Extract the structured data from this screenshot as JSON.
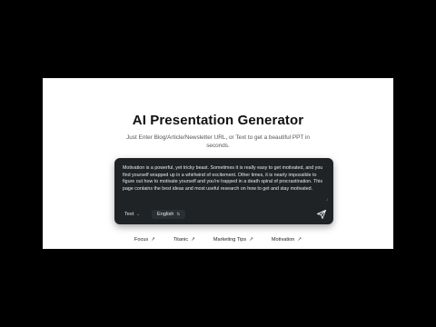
{
  "hero": {
    "title": "AI Presentation Generator",
    "subtitle": "Just Enter Blog/Article/Newsletter URL, or Text to get a beautiful PPT in seconds."
  },
  "input_card": {
    "text": "Motivation is a powerful, yet tricky beast. Sometimes it is really easy to get motivated, and you find yourself wrapped up in a whirlwind of excitement. Other times, it is nearly impossible to figure out how to motivate yourself and you're trapped in a death spiral of procrastination. This page contains the best ideas and most useful research on how to get and stay motivated.",
    "mode_select": {
      "value": "Text",
      "icon": "chevron-down-icon"
    },
    "language_select": {
      "value": "English",
      "icon": "up-down-chevron-icon"
    },
    "send_icon": "send-icon"
  },
  "suggestions": [
    {
      "label": "Focus",
      "icon": "arrow-up-right-icon"
    },
    {
      "label": "Titanic",
      "icon": "arrow-up-right-icon"
    },
    {
      "label": "Marketing Tips",
      "icon": "arrow-up-right-icon"
    },
    {
      "label": "Motivation",
      "icon": "arrow-up-right-icon"
    }
  ],
  "colors": {
    "background": "#000000",
    "page": "#ffffff",
    "card": "#1f2326",
    "card_text": "#e8eaec"
  }
}
